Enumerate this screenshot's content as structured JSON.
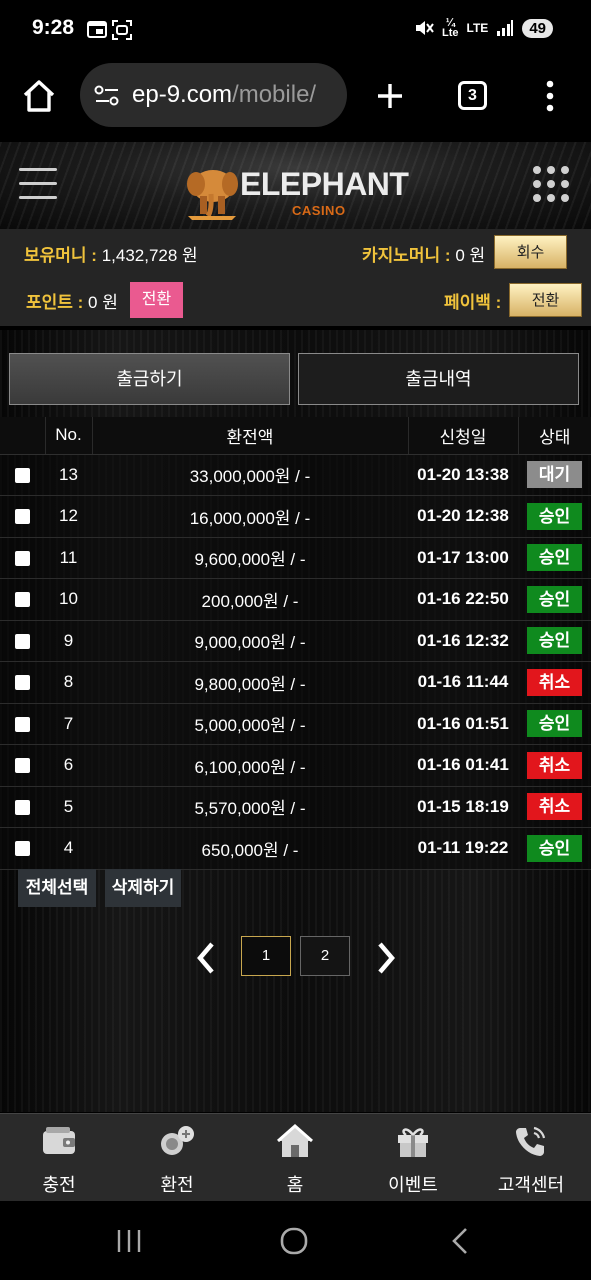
{
  "status_bar": {
    "time": "9:28",
    "network_small_left": "¼",
    "network_small_mid": "Lte",
    "network_lte": "LTE",
    "battery": "49"
  },
  "browser": {
    "url_main": "ep-9.com",
    "url_path": "/mobile/",
    "tab_count": "3"
  },
  "site": {
    "logo_text": "ELEPHANT",
    "logo_sub": "CASINO"
  },
  "money": {
    "holding_label": "보유머니 :",
    "holding_value": "1,432,728 원",
    "casino_label": "카지노머니 :",
    "casino_value": "0 원",
    "recover_button": "회수",
    "point_label": "포인트 :",
    "point_value": "0 원",
    "point_convert_button": "전환",
    "payback_label": "페이백 :",
    "payback_convert_button": "전환"
  },
  "tabs": {
    "withdraw": "출금하기",
    "history": "출금내역"
  },
  "table": {
    "headers": [
      "No.",
      "환전액",
      "신청일",
      "상태"
    ],
    "rows": [
      {
        "no": "13",
        "amount": "33,000,000원 / -",
        "date": "01-20 13:38",
        "status": "대기"
      },
      {
        "no": "12",
        "amount": "16,000,000원 / -",
        "date": "01-20 12:38",
        "status": "승인"
      },
      {
        "no": "11",
        "amount": "9,600,000원 / -",
        "date": "01-17 13:00",
        "status": "승인"
      },
      {
        "no": "10",
        "amount": "200,000원 / -",
        "date": "01-16 22:50",
        "status": "승인"
      },
      {
        "no": "9",
        "amount": "9,000,000원 / -",
        "date": "01-16 12:32",
        "status": "승인"
      },
      {
        "no": "8",
        "amount": "9,800,000원 / -",
        "date": "01-16 11:44",
        "status": "취소"
      },
      {
        "no": "7",
        "amount": "5,000,000원 / -",
        "date": "01-16 01:51",
        "status": "승인"
      },
      {
        "no": "6",
        "amount": "6,100,000원 / -",
        "date": "01-16 01:41",
        "status": "취소"
      },
      {
        "no": "5",
        "amount": "5,570,000원 / -",
        "date": "01-15 18:19",
        "status": "취소"
      },
      {
        "no": "4",
        "amount": "650,000원 / -",
        "date": "01-11 19:22",
        "status": "승인"
      }
    ]
  },
  "status_colors": {
    "대기": "#8c8c8c",
    "승인": "#0f8a1e",
    "취소": "#e2161c"
  },
  "actions": {
    "select_all": "전체선택",
    "delete": "삭제하기"
  },
  "pagination": {
    "pages": [
      "1",
      "2"
    ],
    "current": "1"
  },
  "bottom_nav": [
    {
      "label": "충전",
      "icon": "wallet-icon"
    },
    {
      "label": "환전",
      "icon": "exchange-icon"
    },
    {
      "label": "홈",
      "icon": "home-icon"
    },
    {
      "label": "이벤트",
      "icon": "gift-icon"
    },
    {
      "label": "고객센터",
      "icon": "phone-icon"
    }
  ]
}
